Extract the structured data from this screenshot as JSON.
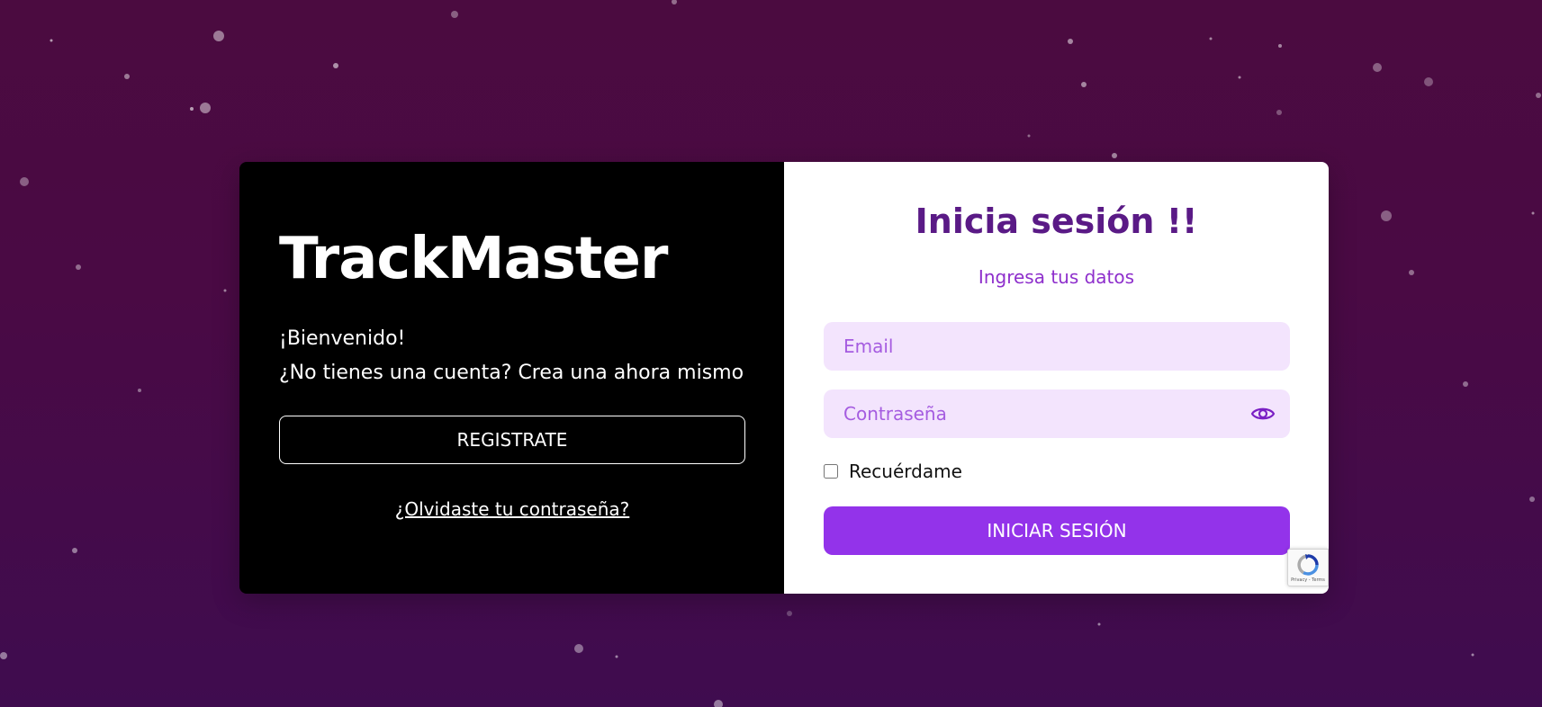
{
  "brand": {
    "name": "TrackMaster"
  },
  "welcome": {
    "greeting": "¡Bienvenido!",
    "prompt": "¿No tienes una cuenta? Crea una ahora mismo"
  },
  "register_button": {
    "label": "REGISTRATE"
  },
  "forgot_password": {
    "label": "¿Olvidaste tu contraseña?"
  },
  "login": {
    "title": "Inicia sesión !!",
    "subtitle": "Ingresa tus datos",
    "email": {
      "placeholder": "Email",
      "value": ""
    },
    "password": {
      "placeholder": "Contraseña",
      "value": "",
      "toggle_icon": "eye-icon"
    },
    "remember_me": {
      "label": "Recuérdame",
      "checked": false
    },
    "submit": {
      "label": "INICIAR SESIÓN"
    }
  },
  "recaptcha": {
    "links": "Privacy - Terms",
    "icon": "recaptcha-icon"
  },
  "colors": {
    "background": "#4a0a44",
    "title": "#5a1a86",
    "subtitle": "#8e2fcc",
    "field_bg": "#f3e4fd",
    "accent": "#9333ea"
  }
}
